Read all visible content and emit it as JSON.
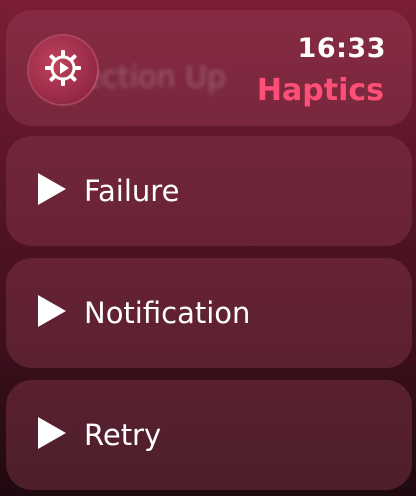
{
  "status": {
    "time": "16:33",
    "app_title": "Haptics"
  },
  "list": {
    "top_item_label": "Direction Up",
    "items": [
      {
        "label": "Failure",
        "icon": "play-icon"
      },
      {
        "label": "Notification",
        "icon": "play-icon"
      },
      {
        "label": "Retry",
        "icon": "play-icon"
      }
    ]
  },
  "colors": {
    "accent": "#ff4f76",
    "background_top": "#7a1e35",
    "background_bottom": "#1f0a10"
  },
  "icons": {
    "settings_button": "gear-icon"
  }
}
